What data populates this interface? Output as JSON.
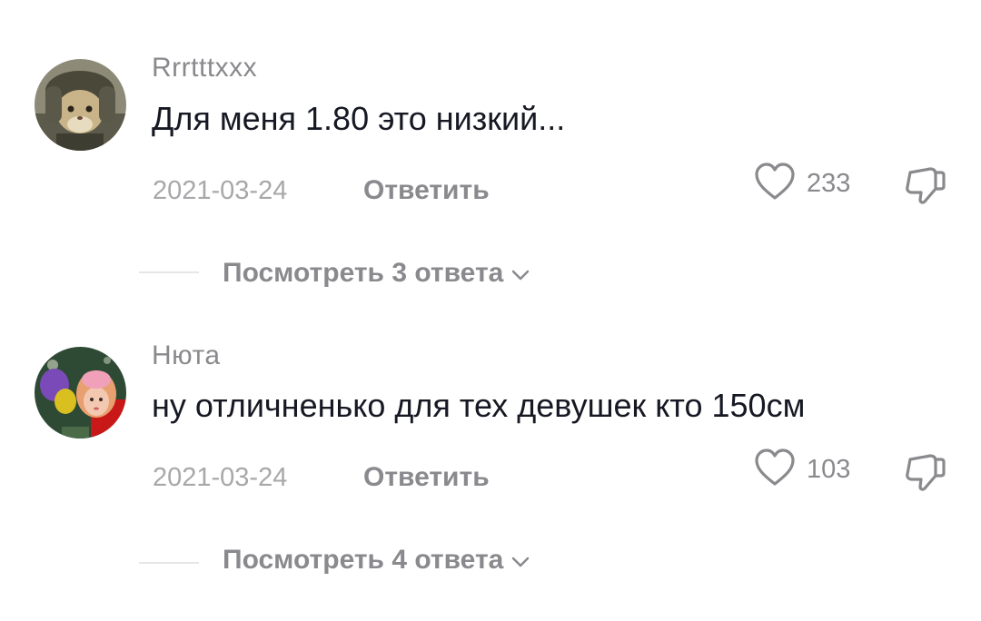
{
  "comments": [
    {
      "username": "Rrrtttxxx",
      "text": "Для меня 1.80 это низкий...",
      "date": "2021-03-24",
      "reply_label": "Ответить",
      "likes": "233",
      "view_replies": "Посмотреть 3 ответа"
    },
    {
      "username": "Нюта",
      "text": "ну отличненько для тех девушек кто 150см",
      "date": "2021-03-24",
      "reply_label": "Ответить",
      "likes": "103",
      "view_replies": "Посмотреть 4 ответа"
    }
  ],
  "icons": {
    "like": "heart-outline-icon",
    "dislike": "thumbs-down-outline-icon",
    "expand": "chevron-down-icon"
  },
  "colors": {
    "text": "#161823",
    "muted": "#8a8a8e",
    "date": "#a8a8ab"
  }
}
